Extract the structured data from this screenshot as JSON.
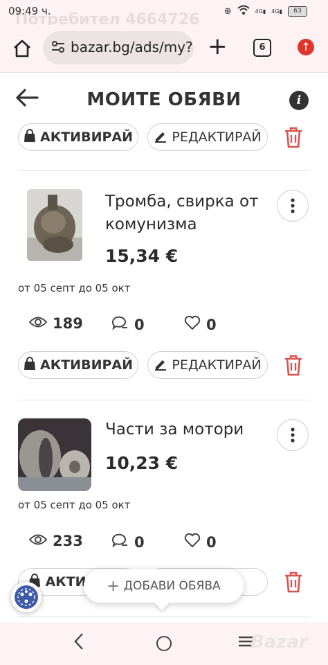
{
  "status": {
    "time": "09:49 ч.",
    "ghost_text": "Потребител 4664726",
    "battery": "63",
    "signal1": "4G",
    "signal2": "4G"
  },
  "browser": {
    "url": "bazar.bg/ads/my?",
    "tab_count": "6"
  },
  "header": {
    "title": "МОИТЕ ОБЯВИ"
  },
  "buttons": {
    "activate": "АКТИВИРАЙ",
    "edit": "РЕДАКТИРАЙ"
  },
  "ads": [
    {
      "title_line1": "Тромба, свирка от",
      "title_line2": "комунизма",
      "price": "15,34 €",
      "dates": "от 05 септ до 05 окт",
      "views": "189",
      "messages": "0",
      "favorites": "0"
    },
    {
      "title_line1": "Части за мотори",
      "price": "10,23 €",
      "dates": "от 05 септ до 05 окт",
      "views": "233",
      "messages": "0",
      "favorites": "0"
    }
  ],
  "third_activate_partial": "АКТИ",
  "fab": {
    "label": "ДОБАВИ ОБЯВА"
  },
  "watermark": "Bazar",
  "colors": {
    "accent_red": "#d9534f",
    "text_dark": "#2b2b2b",
    "chrome_bg": "#fdf3f4"
  }
}
